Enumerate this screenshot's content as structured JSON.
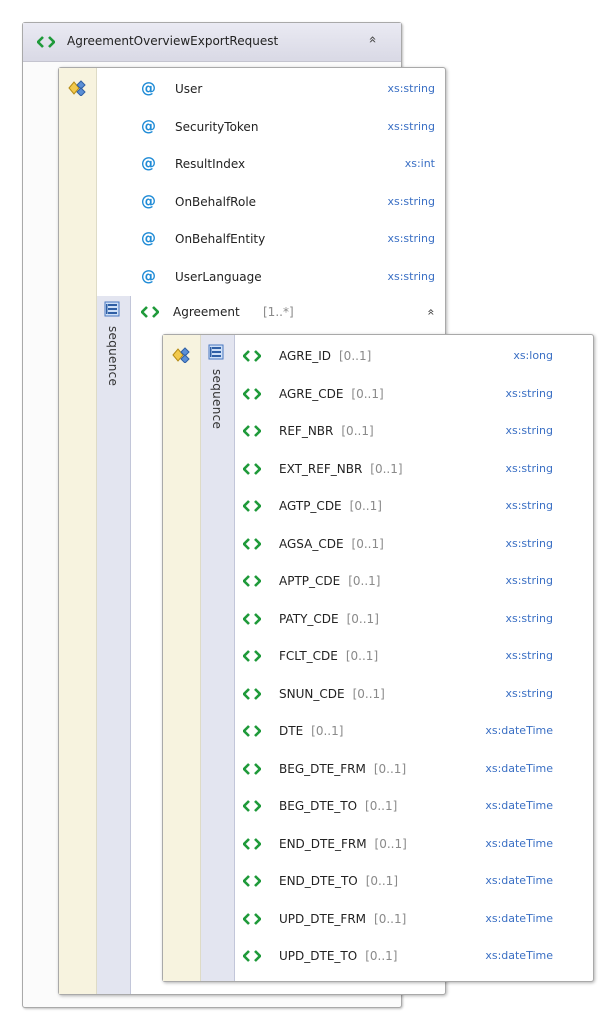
{
  "root": {
    "name": "AgreementOverviewExportRequest",
    "collapse_glyph": "»"
  },
  "attributes": [
    {
      "name": "User",
      "type": "xs:string"
    },
    {
      "name": "SecurityToken",
      "type": "xs:string"
    },
    {
      "name": "ResultIndex",
      "type": "xs:int"
    },
    {
      "name": "OnBehalfRole",
      "type": "xs:string"
    },
    {
      "name": "OnBehalfEntity",
      "type": "xs:string"
    },
    {
      "name": "UserLanguage",
      "type": "xs:string"
    }
  ],
  "outer_sequence_label": "sequence",
  "agreement": {
    "name": "Agreement",
    "cardinality": "[1..*]",
    "collapse_glyph": "»"
  },
  "inner_sequence_label": "sequence",
  "elements": [
    {
      "name": "AGRE_ID",
      "card": "[0..1]",
      "type": "xs:long"
    },
    {
      "name": "AGRE_CDE",
      "card": "[0..1]",
      "type": "xs:string"
    },
    {
      "name": "REF_NBR",
      "card": "[0..1]",
      "type": "xs:string"
    },
    {
      "name": "EXT_REF_NBR",
      "card": "[0..1]",
      "type": "xs:string"
    },
    {
      "name": "AGTP_CDE",
      "card": "[0..1]",
      "type": "xs:string"
    },
    {
      "name": "AGSA_CDE",
      "card": "[0..1]",
      "type": "xs:string"
    },
    {
      "name": "APTP_CDE",
      "card": "[0..1]",
      "type": "xs:string"
    },
    {
      "name": "PATY_CDE",
      "card": "[0..1]",
      "type": "xs:string"
    },
    {
      "name": "FCLT_CDE",
      "card": "[0..1]",
      "type": "xs:string"
    },
    {
      "name": "SNUN_CDE",
      "card": "[0..1]",
      "type": "xs:string"
    },
    {
      "name": "DTE",
      "card": "[0..1]",
      "type": "xs:dateTime"
    },
    {
      "name": "BEG_DTE_FRM",
      "card": "[0..1]",
      "type": "xs:dateTime"
    },
    {
      "name": "BEG_DTE_TO",
      "card": "[0..1]",
      "type": "xs:dateTime"
    },
    {
      "name": "END_DTE_FRM",
      "card": "[0..1]",
      "type": "xs:dateTime"
    },
    {
      "name": "END_DTE_TO",
      "card": "[0..1]",
      "type": "xs:dateTime"
    },
    {
      "name": "UPD_DTE_FRM",
      "card": "[0..1]",
      "type": "xs:dateTime"
    },
    {
      "name": "UPD_DTE_TO",
      "card": "[0..1]",
      "type": "xs:dateTime"
    }
  ],
  "colors": {
    "element_icon": "#1f9a3a",
    "attribute_icon": "#1f8bd6",
    "type_text": "#3a6fc4",
    "cardinality_text": "#8a8a8a"
  }
}
